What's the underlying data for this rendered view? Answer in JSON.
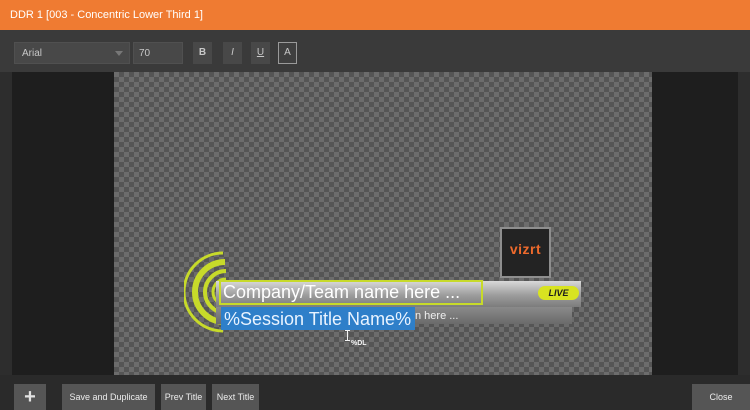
{
  "window": {
    "title": "DDR 1  [003 - Concentric Lower Third 1]"
  },
  "toolbar": {
    "font_family": "Arial",
    "font_size": "70",
    "bold_label": "B",
    "italic_label": "I",
    "underline_label": "U",
    "allcaps_label": "A"
  },
  "canvas": {
    "company_text": "Company/Team name here ...",
    "session_text": "%Session Title Name%",
    "subtext": "n here ...",
    "live_badge": "LIVE",
    "logo_text": "vizrt",
    "cursor_label": "%DL"
  },
  "bottombar": {
    "add_label": "+",
    "save_duplicate_label": "Save and Duplicate",
    "prev_title_label": "Prev Title",
    "next_title_label": "Next Title",
    "close_label": "Close"
  },
  "colors": {
    "titlebar": "#ef7b32",
    "accent_green": "#c7da2a",
    "selection_blue": "#2e7fc9",
    "logo_orange": "#ee6a2c"
  }
}
